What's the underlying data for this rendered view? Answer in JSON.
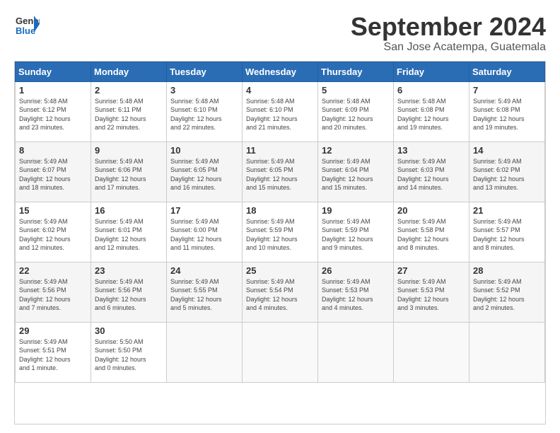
{
  "logo": {
    "line1": "General",
    "line2": "Blue"
  },
  "title": "September 2024",
  "location": "San Jose Acatempa, Guatemala",
  "headers": [
    "Sunday",
    "Monday",
    "Tuesday",
    "Wednesday",
    "Thursday",
    "Friday",
    "Saturday"
  ],
  "weeks": [
    [
      {
        "day": "1",
        "sunrise": "5:48 AM",
        "sunset": "6:12 PM",
        "daylight": "12 hours and 23 minutes."
      },
      {
        "day": "2",
        "sunrise": "5:48 AM",
        "sunset": "6:11 PM",
        "daylight": "12 hours and 22 minutes."
      },
      {
        "day": "3",
        "sunrise": "5:48 AM",
        "sunset": "6:10 PM",
        "daylight": "12 hours and 22 minutes."
      },
      {
        "day": "4",
        "sunrise": "5:48 AM",
        "sunset": "6:10 PM",
        "daylight": "12 hours and 21 minutes."
      },
      {
        "day": "5",
        "sunrise": "5:48 AM",
        "sunset": "6:09 PM",
        "daylight": "12 hours and 20 minutes."
      },
      {
        "day": "6",
        "sunrise": "5:48 AM",
        "sunset": "6:08 PM",
        "daylight": "12 hours and 19 minutes."
      },
      {
        "day": "7",
        "sunrise": "5:49 AM",
        "sunset": "6:08 PM",
        "daylight": "12 hours and 19 minutes."
      }
    ],
    [
      {
        "day": "8",
        "sunrise": "5:49 AM",
        "sunset": "6:07 PM",
        "daylight": "12 hours and 18 minutes."
      },
      {
        "day": "9",
        "sunrise": "5:49 AM",
        "sunset": "6:06 PM",
        "daylight": "12 hours and 17 minutes."
      },
      {
        "day": "10",
        "sunrise": "5:49 AM",
        "sunset": "6:05 PM",
        "daylight": "12 hours and 16 minutes."
      },
      {
        "day": "11",
        "sunrise": "5:49 AM",
        "sunset": "6:05 PM",
        "daylight": "12 hours and 15 minutes."
      },
      {
        "day": "12",
        "sunrise": "5:49 AM",
        "sunset": "6:04 PM",
        "daylight": "12 hours and 15 minutes."
      },
      {
        "day": "13",
        "sunrise": "5:49 AM",
        "sunset": "6:03 PM",
        "daylight": "12 hours and 14 minutes."
      },
      {
        "day": "14",
        "sunrise": "5:49 AM",
        "sunset": "6:02 PM",
        "daylight": "12 hours and 13 minutes."
      }
    ],
    [
      {
        "day": "15",
        "sunrise": "5:49 AM",
        "sunset": "6:02 PM",
        "daylight": "12 hours and 12 minutes."
      },
      {
        "day": "16",
        "sunrise": "5:49 AM",
        "sunset": "6:01 PM",
        "daylight": "12 hours and 12 minutes."
      },
      {
        "day": "17",
        "sunrise": "5:49 AM",
        "sunset": "6:00 PM",
        "daylight": "12 hours and 11 minutes."
      },
      {
        "day": "18",
        "sunrise": "5:49 AM",
        "sunset": "5:59 PM",
        "daylight": "12 hours and 10 minutes."
      },
      {
        "day": "19",
        "sunrise": "5:49 AM",
        "sunset": "5:59 PM",
        "daylight": "12 hours and 9 minutes."
      },
      {
        "day": "20",
        "sunrise": "5:49 AM",
        "sunset": "5:58 PM",
        "daylight": "12 hours and 8 minutes."
      },
      {
        "day": "21",
        "sunrise": "5:49 AM",
        "sunset": "5:57 PM",
        "daylight": "12 hours and 8 minutes."
      }
    ],
    [
      {
        "day": "22",
        "sunrise": "5:49 AM",
        "sunset": "5:56 PM",
        "daylight": "12 hours and 7 minutes."
      },
      {
        "day": "23",
        "sunrise": "5:49 AM",
        "sunset": "5:56 PM",
        "daylight": "12 hours and 6 minutes."
      },
      {
        "day": "24",
        "sunrise": "5:49 AM",
        "sunset": "5:55 PM",
        "daylight": "12 hours and 5 minutes."
      },
      {
        "day": "25",
        "sunrise": "5:49 AM",
        "sunset": "5:54 PM",
        "daylight": "12 hours and 4 minutes."
      },
      {
        "day": "26",
        "sunrise": "5:49 AM",
        "sunset": "5:53 PM",
        "daylight": "12 hours and 4 minutes."
      },
      {
        "day": "27",
        "sunrise": "5:49 AM",
        "sunset": "5:53 PM",
        "daylight": "12 hours and 3 minutes."
      },
      {
        "day": "28",
        "sunrise": "5:49 AM",
        "sunset": "5:52 PM",
        "daylight": "12 hours and 2 minutes."
      }
    ],
    [
      {
        "day": "29",
        "sunrise": "5:49 AM",
        "sunset": "5:51 PM",
        "daylight": "12 hours and 1 minute."
      },
      {
        "day": "30",
        "sunrise": "5:50 AM",
        "sunset": "5:50 PM",
        "daylight": "12 hours and 0 minutes."
      },
      null,
      null,
      null,
      null,
      null
    ]
  ]
}
